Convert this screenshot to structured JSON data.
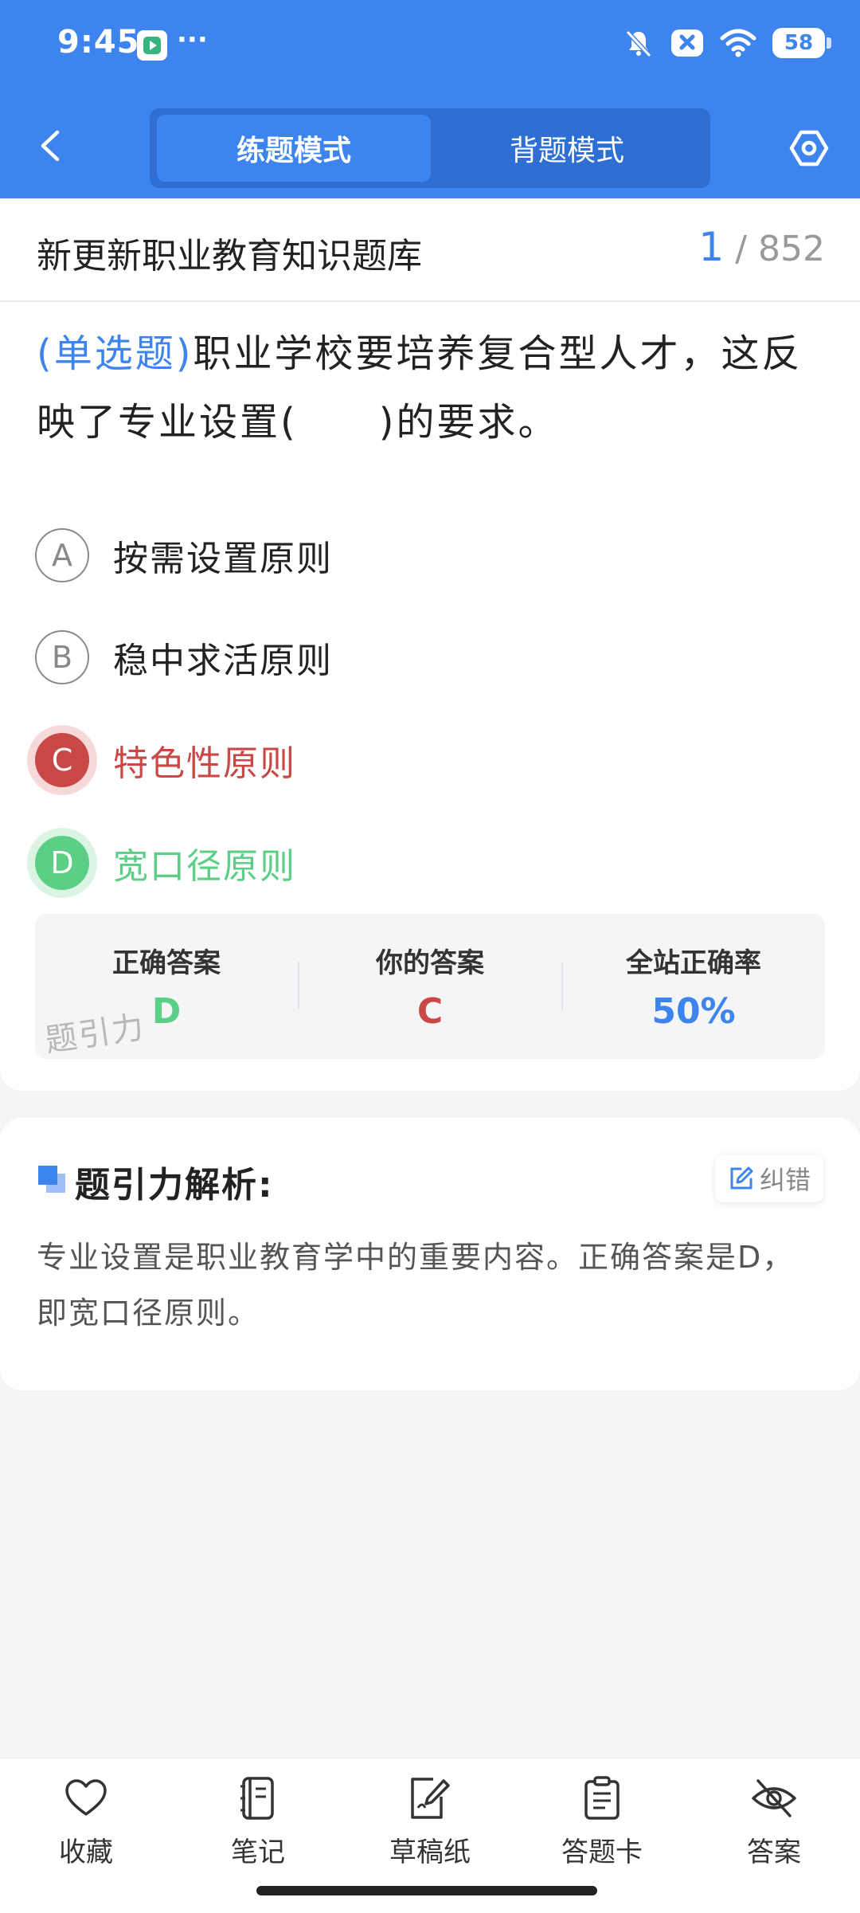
{
  "status_bar": {
    "time": "9:45",
    "dots": "···",
    "battery": "58"
  },
  "nav": {
    "tab_practice": "练题模式",
    "tab_recite": "背题模式"
  },
  "bank": {
    "title": "新更新职业教育知识题库",
    "current": "1",
    "total": "/ 852"
  },
  "question": {
    "type": "(单选题)",
    "text": "职业学校要培养复合型人才，这反映了专业设置(　　)的要求。",
    "options": [
      {
        "letter": "A",
        "text": "按需设置原则",
        "state": "normal"
      },
      {
        "letter": "B",
        "text": "稳中求活原则",
        "state": "normal"
      },
      {
        "letter": "C",
        "text": "特色性原则",
        "state": "wrong"
      },
      {
        "letter": "D",
        "text": "宽口径原则",
        "state": "correct"
      }
    ]
  },
  "answers": {
    "correct_label": "正确答案",
    "correct_value": "D",
    "yours_label": "你的答案",
    "yours_value": "C",
    "rate_label": "全站正确率",
    "rate_value": "50%",
    "watermark": "题引力"
  },
  "analysis": {
    "title": "题引力解析:",
    "correct_btn": "纠错",
    "body": "专业设置是职业教育学中的重要内容。正确答案是D，即宽口径原则。"
  },
  "toolbar": {
    "favorite": "收藏",
    "notes": "笔记",
    "draft": "草稿纸",
    "answer_card": "答题卡",
    "answer": "答案"
  },
  "colors": {
    "primary": "#3e84ee",
    "wrong": "#c94846",
    "correct": "#5ccf86"
  }
}
